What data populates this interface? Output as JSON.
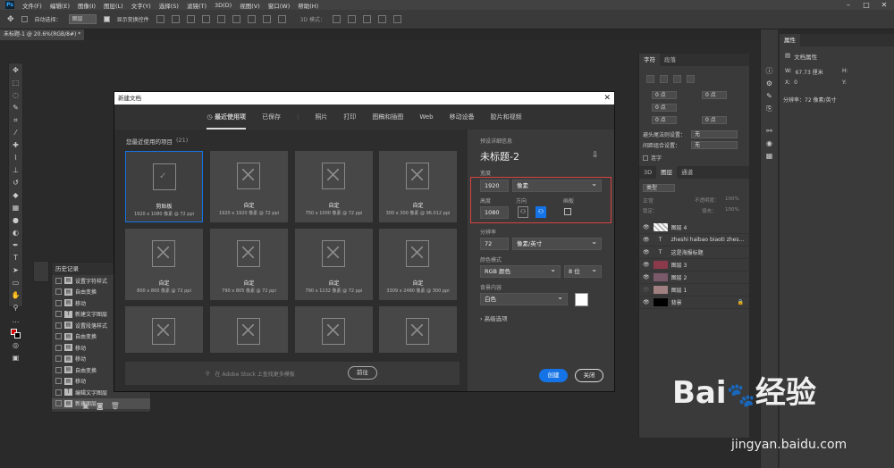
{
  "menu": {
    "items": [
      "文件(F)",
      "编辑(E)",
      "图像(I)",
      "图层(L)",
      "文字(Y)",
      "选择(S)",
      "滤镜(T)",
      "3D(D)",
      "视图(V)",
      "窗口(W)",
      "帮助(H)"
    ]
  },
  "options": {
    "auto_select": "自动选择：",
    "auto_select_value": "图层",
    "show_transform": "显示变换控件",
    "mode3d": "3D 模式："
  },
  "doc_tab": "未标题-1 @ 20.6%(RGB/8#) *",
  "history": {
    "title": "历史记录",
    "items": [
      "设置字符样式",
      "自由变换",
      "移动",
      "新建文字图层",
      "设置段落样式",
      "自由变换",
      "移动",
      "移动",
      "自由变换",
      "移动",
      "编辑文字图层",
      "新建图层"
    ]
  },
  "char_panel": {
    "tabs": [
      "字符",
      "段落"
    ],
    "fields": [
      "0 点",
      "0 点",
      "0 点",
      "0 点",
      "0 点"
    ],
    "rows": [
      {
        "label": "避头尾法则设置：",
        "value": "无"
      },
      {
        "label": "间距组合设置：",
        "value": "无"
      }
    ],
    "hyphen": "连字"
  },
  "layers_panel": {
    "tabs": [
      "3D",
      "图层",
      "通道"
    ],
    "kind": "类型",
    "mode": "正常",
    "opacity_label": "不透明度：",
    "opacity": "100%",
    "lock": "锁定：",
    "fill_label": "填充：",
    "fill": "100%",
    "layers": [
      "图层 4",
      "zheshi haibao biaoti zhes...",
      "这是海报标题",
      "图层 3",
      "图层 2",
      "图层 1",
      "背景"
    ]
  },
  "properties": {
    "title": "属性",
    "doc": "文档属性",
    "w_label": "W:",
    "w_value": "67.73 厘米",
    "h_label": "H:",
    "x_label": "X:",
    "x_value": "0",
    "y_label": "Y:",
    "res": "分辨率：72 像素/英寸"
  },
  "dialog": {
    "title": "新建文档",
    "close": "✕",
    "tabs": [
      "最近使用项",
      "已保存",
      "照片",
      "打印",
      "图稿和插图",
      "Web",
      "移动设备",
      "胶片和视频"
    ],
    "recent_label": "您最近使用的项目",
    "recent_count": "(21)",
    "cards": [
      {
        "name": "剪贴板",
        "size": "1920 x 1080 像素 @ 72 ppi"
      },
      {
        "name": "自定",
        "size": "1920 x 1920 像素 @ 72 ppi"
      },
      {
        "name": "自定",
        "size": "750 x 1000 像素 @ 72 ppi"
      },
      {
        "name": "自定",
        "size": "300 x 300 像素 @ 96.012 ppi"
      },
      {
        "name": "自定",
        "size": "800 x 800 像素 @ 72 ppi"
      },
      {
        "name": "自定",
        "size": "790 x 805 像素 @ 72 ppi"
      },
      {
        "name": "自定",
        "size": "790 x 1132 像素 @ 72 ppi"
      },
      {
        "name": "自定",
        "size": "3309 x 2480 像素 @ 300 ppi"
      }
    ],
    "search_placeholder": "在 Adobe Stock 上查找更多模板",
    "go": "前往",
    "preset_label": "预设详细信息",
    "doc_name": "未标题-2",
    "width_label": "宽度",
    "width": "1920",
    "width_unit": "像素",
    "height_label": "高度",
    "height": "1080",
    "orient_label": "方向",
    "artboard_label": "画板",
    "res_label": "分辨率",
    "res": "72",
    "res_unit": "像素/英寸",
    "color_label": "颜色模式",
    "color": "RGB 颜色",
    "bits": "8 位",
    "bg_label": "背景内容",
    "bg": "白色",
    "bg_color": "#ffffff",
    "advanced": "高级选项",
    "create": "创建",
    "close_btn": "关闭"
  },
  "watermark": {
    "brand": "Bai",
    "brand2": "经验",
    "url": "jingyan.baidu.com"
  }
}
